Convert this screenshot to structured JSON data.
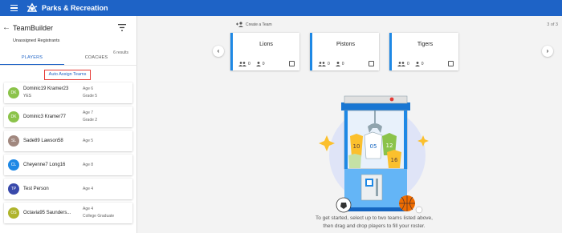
{
  "app": {
    "title": "Parks & Recreation"
  },
  "sidebar": {
    "title": "TeamBuilder",
    "unassigned_label": "Unassigned Registrants",
    "results_count": "6 results",
    "tabs": [
      {
        "label": "PLAYERS",
        "active": true
      },
      {
        "label": "COACHES",
        "active": false
      }
    ],
    "auto_assign_label": "Auto Assign Teams",
    "registrants": [
      {
        "initials": "DK",
        "name": "Dominic19 Kramer23",
        "sub": "YES",
        "age": "Age 6",
        "grade": "Grade 5",
        "avatar_color": "#8bc34a"
      },
      {
        "initials": "DK",
        "name": "Dominic3 Kramer77",
        "sub": "",
        "age": "Age 7",
        "grade": "Grade 2",
        "avatar_color": "#8bc34a"
      },
      {
        "initials": "SL",
        "name": "Sade89 Lawson58",
        "sub": "",
        "age": "Age 5",
        "grade": "",
        "avatar_color": "#a1887f"
      },
      {
        "initials": "CL",
        "name": "Cheyenne7 Long16",
        "sub": "",
        "age": "Age 8",
        "grade": "",
        "avatar_color": "#1e88e5"
      },
      {
        "initials": "TP",
        "name": "Test Person",
        "sub": "",
        "age": "Age 4",
        "grade": "",
        "avatar_color": "#3949ab"
      },
      {
        "initials": "OS",
        "name": "Octavia95 Saunders...",
        "sub": "",
        "age": "Age 4",
        "grade": "College Graduate",
        "avatar_color": "#afb42b"
      }
    ]
  },
  "main": {
    "create_team_label": "Create a Team",
    "pager": "3 of 3",
    "teams": [
      {
        "name": "Lions",
        "players": "0",
        "coaches": "0",
        "checked": false
      },
      {
        "name": "Pistons",
        "players": "0",
        "coaches": "0",
        "checked": false
      },
      {
        "name": "Tigers",
        "players": "0",
        "coaches": "0",
        "checked": false
      }
    ],
    "help_line1": "To get started, select up to two teams listed above,",
    "help_line2": "then drag and drop players to fill your roster.",
    "jersey_numbers": [
      "10",
      "05",
      "12",
      "16"
    ]
  },
  "colors": {
    "primary": "#1e63c6",
    "team_accent": "#1e88e5",
    "highlight_border": "#e53935"
  },
  "icons": [
    "menu-icon",
    "parks-logo-icon",
    "back-arrow-icon",
    "filter-icon",
    "add-team-icon",
    "chevron-left-icon",
    "chevron-right-icon",
    "players-icon",
    "coach-icon"
  ]
}
